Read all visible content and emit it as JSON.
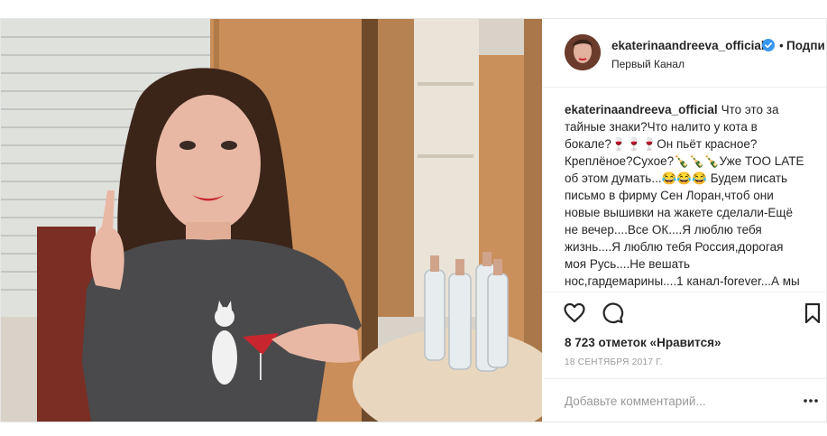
{
  "post": {
    "username": "ekaterinaandreeva_official",
    "follow_label": "Подпи",
    "location": "Первый Канал",
    "caption_user": "ekaterinaandreeva_official",
    "caption_text": "Что это за тайные знаки?Что налито у кота в бокале?🍷🍷🍷Он пьёт красное?Креплёное?Сухое?🍾🍾🍾Уже TOO LATE об этом думать...😂😂😂 Будем писать письмо в фирму Сен Лоран,чтоб они новые вышивки на жакете сделали-Ещё не вечер....Все ОК....Я люблю тебя жизнь....Я люблю тебя Россия,дорогая моя Русь....Не вешать нос,гардемарины....1 канал-forever...А мы всем советуем пить воду,а не красненькое,🍷🍷🍷как",
    "likes": "8 723 отметок «Нравится»",
    "date": "18 СЕНТЯБРЯ 2017 Г.",
    "comment_placeholder": "Добавьте комментарий..."
  },
  "icons": {
    "verified": "verified-badge-icon",
    "like": "heart-icon",
    "comment": "speech-bubble-icon",
    "save": "bookmark-icon",
    "more": "more-options-icon"
  },
  "colors": {
    "text": "#262626",
    "muted": "#999999",
    "verified": "#3897f0",
    "border": "#efefef"
  }
}
